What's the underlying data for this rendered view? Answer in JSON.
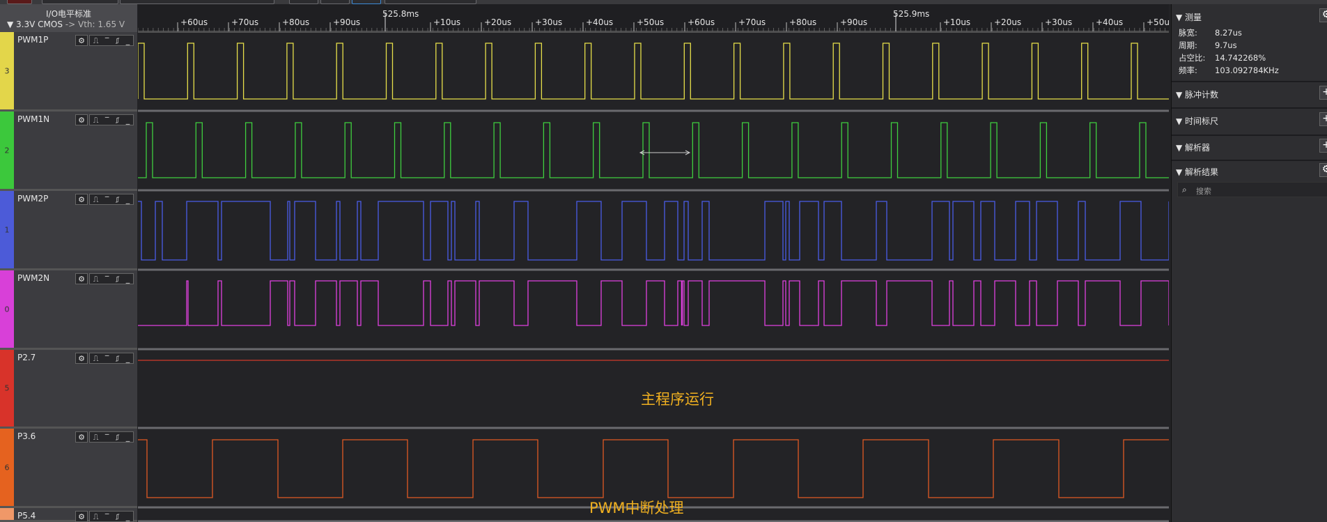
{
  "io_standard": {
    "title": "I/O电平标准",
    "level": "▼ 3.3V CMOS",
    "vth": "-> Vth: 1.65 V"
  },
  "ruler": {
    "labels_a": [
      "+60us",
      "+70us",
      "+80us",
      "+90us",
      "+10us",
      "+20us",
      "+30us",
      "+40us",
      "+50us",
      "+60us",
      "+70us",
      "+80us",
      "+90us",
      "+10us",
      "+20us",
      "+30us",
      "+40us",
      "+50us"
    ],
    "major_a": "525.8ms",
    "major_b": "525.9ms"
  },
  "channels": [
    {
      "name": "PWM1P",
      "num": "3",
      "color": "#e8e04a",
      "strip": "#e3d64a"
    },
    {
      "name": "PWM1N",
      "num": "2",
      "color": "#3fcf3f",
      "strip": "#3cc83c"
    },
    {
      "name": "PWM2P",
      "num": "1",
      "color": "#4a5de8",
      "strip": "#4c5bd8"
    },
    {
      "name": "PWM2N",
      "num": "0",
      "color": "#e040e0",
      "strip": "#d840d8"
    },
    {
      "name": "P2.7",
      "num": "5",
      "color": "#d03a2a",
      "strip": "#d8332a"
    },
    {
      "name": "P3.6",
      "num": "6",
      "color": "#e05a24",
      "strip": "#e5621f"
    },
    {
      "name": "P5.4",
      "num": "",
      "color": "#e88060",
      "strip": "#f09868"
    }
  ],
  "annotations": {
    "main_loop": "主程序运行",
    "pwm_isr": "PWM中断处理"
  },
  "panel": {
    "measure_title": "▼ 测量",
    "measure": [
      {
        "k": "脉宽:",
        "v": "8.27us"
      },
      {
        "k": "周期:",
        "v": "9.7us"
      },
      {
        "k": "占空比:",
        "v": "14.742268%"
      },
      {
        "k": "频率:",
        "v": "103.092784KHz"
      }
    ],
    "pulse_count": "▼ 脉冲计数",
    "time_ruler": "▼ 时间标尺",
    "analyzer": "▼ 解析器",
    "results": "▼ 解析结果",
    "search_placeholder": "搜索"
  },
  "icons": {
    "gear": "gear-icon",
    "edge": "edge-trigger-icon",
    "plus": "plus-icon",
    "search": "search-icon"
  }
}
